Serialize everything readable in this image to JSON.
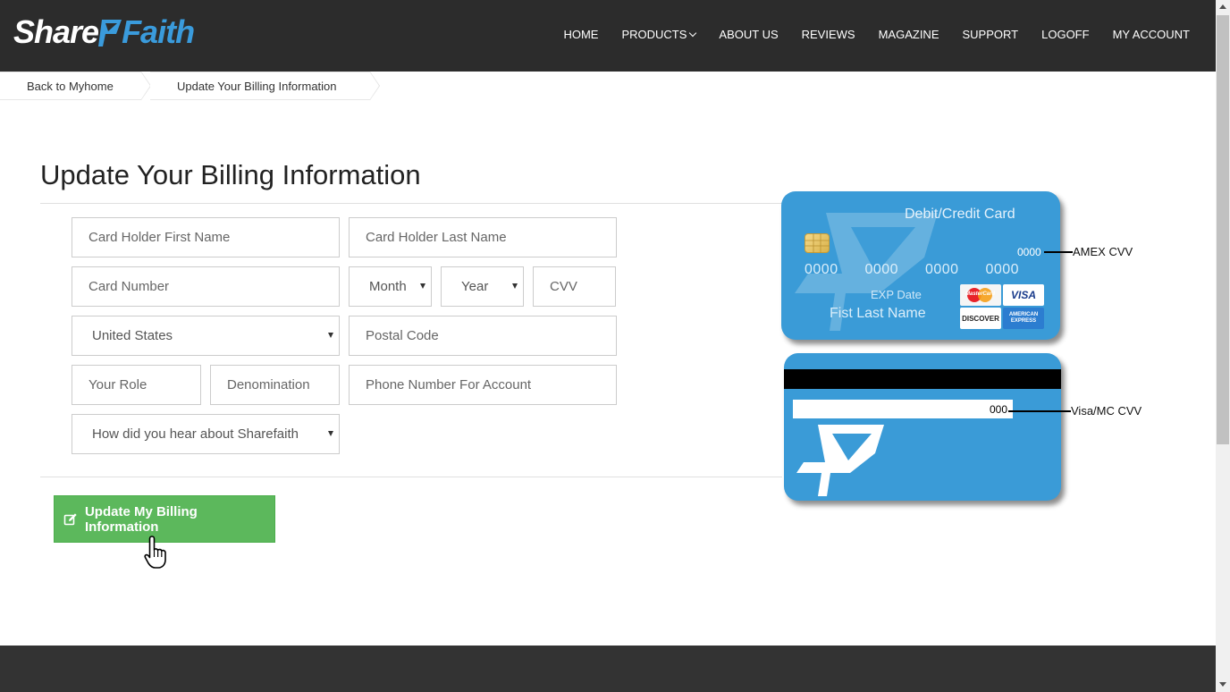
{
  "brand": {
    "logo_share": "Share",
    "logo_faith": "Faith",
    "accent": "#3a9bdc"
  },
  "nav": {
    "items": [
      "HOME",
      "PRODUCTS",
      "ABOUT US",
      "REVIEWS",
      "MAGAZINE",
      "SUPPORT",
      "LOGOFF",
      "MY ACCOUNT"
    ]
  },
  "breadcrumb": {
    "items": [
      "Back to Myhome",
      "Update Your Billing Information"
    ]
  },
  "page": {
    "title": "Update Your Billing Information"
  },
  "form": {
    "first_name_placeholder": "Card Holder First Name",
    "last_name_placeholder": "Card Holder Last Name",
    "card_number_placeholder": "Card Number",
    "month": "Month",
    "year": "Year",
    "cvv_placeholder": "CVV",
    "country": "United States",
    "postal_code_placeholder": "Postal Code",
    "role_placeholder": "Your Role",
    "denomination_placeholder": "Denomination",
    "phone_placeholder": "Phone Number For Account",
    "hear_about": "How did you hear about Sharefaith",
    "submit_label": "Update My Billing Information",
    "submit_color": "#5cb85c"
  },
  "card_front": {
    "title": "Debit/Credit Card",
    "amex_cvv": "0000",
    "number": "0000  0000  0000  0000",
    "exp_label": "EXP Date",
    "name": "Fist Last Name",
    "color": "#3a9bd7",
    "logos": {
      "mastercard": "MasterCard",
      "visa": "VISA",
      "discover": "DISCOVER",
      "amex": "AMERICAN EXPRESS"
    }
  },
  "card_back": {
    "visa_mc_cvv": "000"
  },
  "cvv_labels": {
    "amex": "AMEX CVV",
    "visa_mc": "Visa/MC CVV"
  }
}
